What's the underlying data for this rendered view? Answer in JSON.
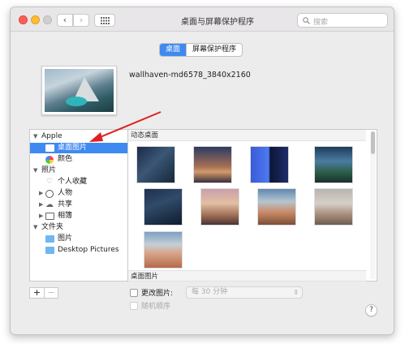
{
  "window": {
    "title": "桌面与屏幕保护程序",
    "search_placeholder": "搜索"
  },
  "tabs": [
    {
      "label": "桌面",
      "active": true
    },
    {
      "label": "屏幕保护程序",
      "active": false
    }
  ],
  "current_wallpaper": {
    "name": "wallhaven-md6578_3840x2160"
  },
  "sidebar": {
    "groups": [
      {
        "label": "Apple",
        "expanded": true,
        "items": [
          {
            "label": "桌面图片",
            "selected": true,
            "icon": "folder-icon"
          },
          {
            "label": "颜色",
            "selected": false,
            "icon": "color-wheel-icon"
          }
        ]
      },
      {
        "label": "照片",
        "expanded": true,
        "items": [
          {
            "label": "个人收藏",
            "icon": "heart-icon"
          },
          {
            "label": "人物",
            "icon": "person-icon"
          },
          {
            "label": "共享",
            "icon": "cloud-icon"
          },
          {
            "label": "相簿",
            "icon": "album-folder-icon"
          }
        ]
      },
      {
        "label": "文件夹",
        "expanded": true,
        "items": [
          {
            "label": "图片",
            "icon": "folder-icon"
          },
          {
            "label": "Desktop Pictures",
            "icon": "folder-icon"
          }
        ]
      }
    ],
    "add_label": "+",
    "remove_label": "−"
  },
  "content": {
    "section_dynamic": "动态桌面",
    "section_desktop": "桌面图片",
    "wallpapers_count": 9
  },
  "options": {
    "change_picture_label": "更改图片:",
    "interval_value": "每 30 分钟",
    "random_order_label": "随机顺序",
    "help_label": "?"
  },
  "colors": {
    "accent": "#3f8af1",
    "annotation_arrow": "#e02020"
  }
}
